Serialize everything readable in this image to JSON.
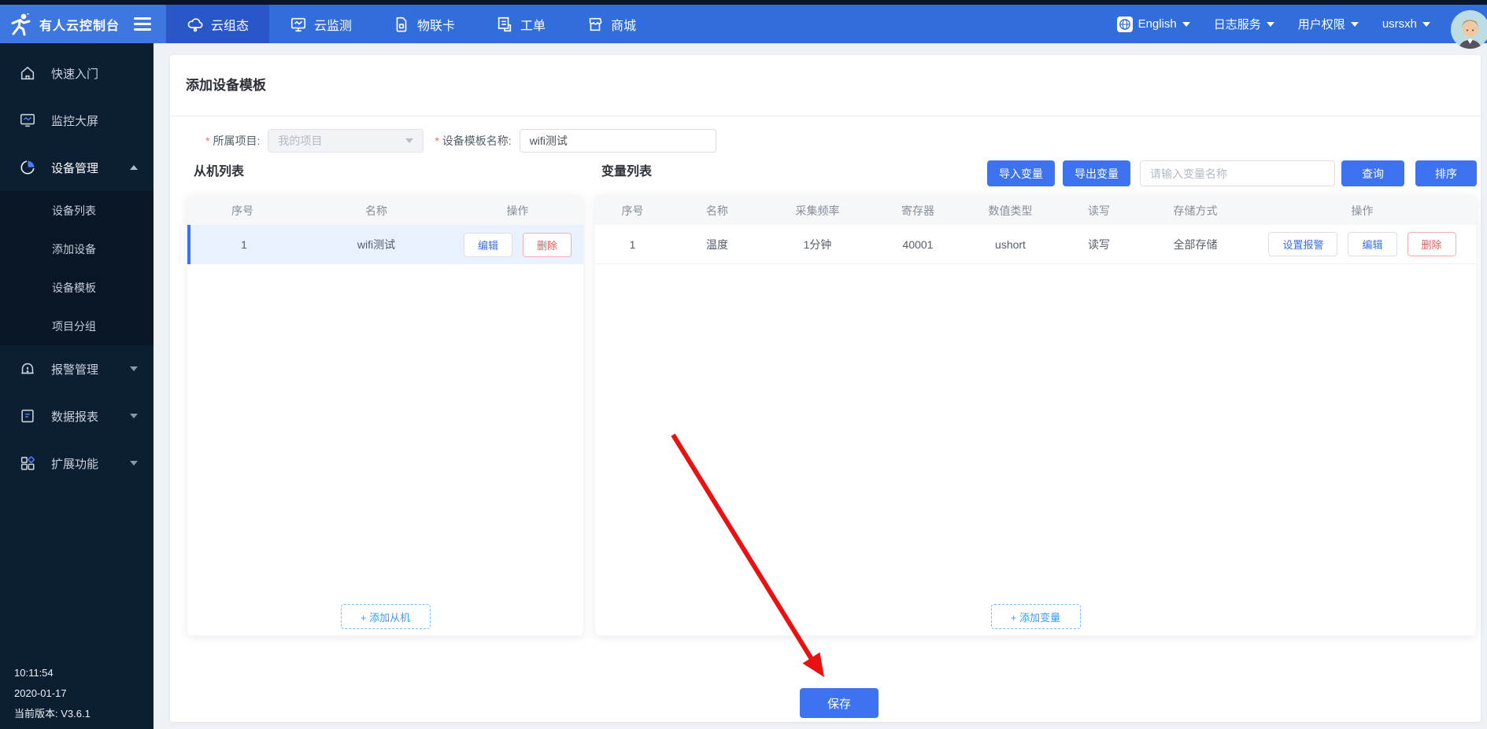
{
  "navbar": {
    "brand": "有人云控制台",
    "tabs": [
      {
        "label": "云组态",
        "icon": "cloud-icon"
      },
      {
        "label": "云监测",
        "icon": "monitor-icon"
      },
      {
        "label": "物联卡",
        "icon": "sim-card-icon"
      },
      {
        "label": "工单",
        "icon": "work-order-icon"
      },
      {
        "label": "商城",
        "icon": "store-icon"
      }
    ],
    "language": "English",
    "log_service": "日志服务",
    "user_permission": "用户权限",
    "username": "usrsxh"
  },
  "sidebar": {
    "items": [
      {
        "label": "快速入门"
      },
      {
        "label": "监控大屏"
      },
      {
        "label": "设备管理"
      },
      {
        "label": "报警管理"
      },
      {
        "label": "数据报表"
      },
      {
        "label": "扩展功能"
      }
    ],
    "device_children": [
      "设备列表",
      "添加设备",
      "设备模板",
      "项目分组"
    ],
    "footer": {
      "time": "10:11:54",
      "date": "2020-01-17",
      "version": "当前版本: V3.6.1"
    }
  },
  "page": {
    "title": "添加设备模板",
    "form": {
      "required_mark": "*",
      "project_label": "所属项目:",
      "project_value": "我的项目",
      "template_label": "设备模板名称:",
      "template_value": "wifi测试"
    },
    "slave_panel": {
      "title": "从机列表",
      "columns": [
        "序号",
        "名称",
        "操作"
      ],
      "row": {
        "index": "1",
        "name": "wifi测试"
      },
      "edit": "编辑",
      "delete": "删除",
      "add_button": "+ 添加从机"
    },
    "variable_panel": {
      "title": "变量列表",
      "toolbar": {
        "import": "导入变量",
        "export": "导出变量",
        "search_placeholder": "请输入变量名称",
        "query": "查询",
        "sort": "排序"
      },
      "columns": [
        "序号",
        "名称",
        "采集频率",
        "寄存器",
        "数值类型",
        "读写",
        "存储方式",
        "操作"
      ],
      "row": {
        "index": "1",
        "name": "温度",
        "frequency": "1分钟",
        "register": "40001",
        "data_type": "ushort",
        "rw": "读写",
        "storage": "全部存储"
      },
      "set_alarm": "设置报警",
      "edit": "编辑",
      "delete": "删除",
      "add_button": "+ 添加变量"
    },
    "save_button": "保存"
  },
  "colors": {
    "navbar": "#316ddb",
    "navbar_active": "#2a57c8",
    "brand_bg": "#3d77df",
    "sidebar": "#0c1e32",
    "sidebar_submenu": "#081626",
    "primary": "#3e73f0",
    "link_blue": "#3d6fe8",
    "light_blue": "#3a9bfe",
    "danger": "#f25555",
    "selected_row": "#e9f1fe",
    "arrow_red": "#e81212"
  }
}
